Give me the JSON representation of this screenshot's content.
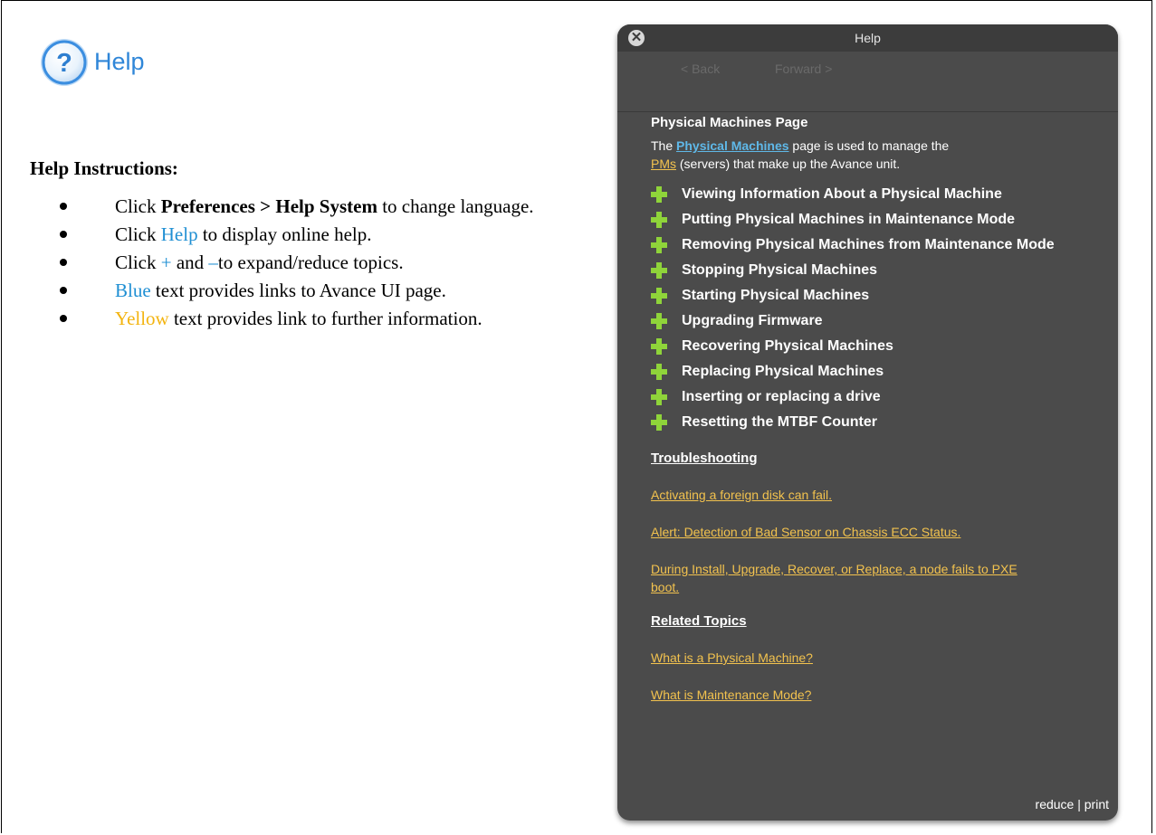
{
  "left": {
    "logo_title": "Help",
    "heading": "Help Instructions:",
    "items": [
      {
        "pre": "Click ",
        "bold": "Preferences > Help System",
        "post": " to change language."
      },
      {
        "pre": "Click ",
        "link": "Help",
        "post": " to display online help."
      },
      {
        "pre": "Click ",
        "plus": "+",
        "mid": " and ",
        "minus": "–",
        "post": "to expand/reduce topics."
      },
      {
        "blue": "Blue",
        "post": " text provides links to Avance UI page."
      },
      {
        "yellow": "Yellow",
        "post": " text provides link to further information."
      }
    ]
  },
  "panel": {
    "title": "Help",
    "close_glyph": "✕",
    "back": "< Back",
    "forward": "Forward >",
    "page_title": "Physical Machines Page",
    "intro": {
      "t1": "The ",
      "link1": "Physical Machines",
      "t2": " page is used to manage the ",
      "link2": "PMs",
      "t3": " (servers) that make up the Avance unit."
    },
    "topics": [
      "Viewing Information About a Physical Machine",
      "Putting Physical Machines in Maintenance Mode",
      "Removing Physical Machines from Maintenance Mode",
      "Stopping Physical Machines",
      "Starting Physical Machines",
      "Upgrading Firmware",
      "Recovering Physical Machines",
      "Replacing Physical Machines",
      "Inserting or replacing a drive",
      "Resetting the MTBF Counter"
    ],
    "troubleshooting_heading": "Troubleshooting",
    "troubleshooting_links": [
      "Activating a foreign disk can fail.",
      "Alert: Detection of Bad Sensor on Chassis ECC Status.",
      "During Install, Upgrade, Recover, or Replace, a node fails to PXE boot."
    ],
    "related_heading": "Related Topics",
    "related_links": [
      "What is a Physical Machine?",
      "What is Maintenance Mode?"
    ],
    "footer": {
      "reduce": "reduce",
      "sep": " | ",
      "print": "print"
    }
  },
  "colors": {
    "panel_bg": "#4b4b4b",
    "blue_link": "#1f8fd3",
    "yellow_link": "#f3b410",
    "plus_green": "#8fd43a"
  },
  "icons": [
    "help-question-icon",
    "close-icon",
    "plus-icon"
  ]
}
